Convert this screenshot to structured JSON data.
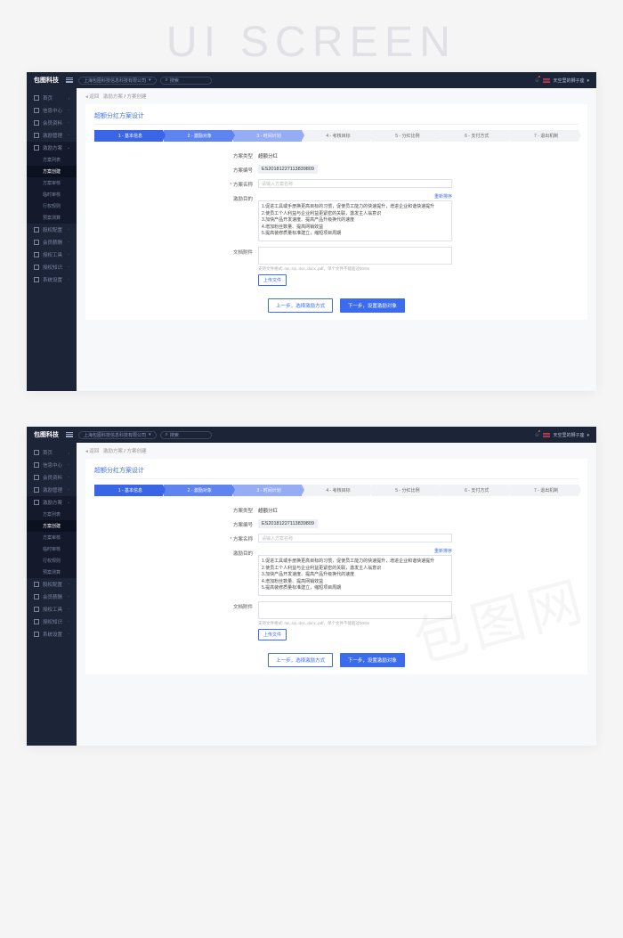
{
  "bgtitle": "UI SCREEN",
  "watermark": "包图网",
  "header": {
    "brand": "包图科技",
    "company": "上海包图科技信息科技有限公司",
    "search_ph": "搜索",
    "user": "天空里的狮子座"
  },
  "sidebar": {
    "items": [
      {
        "label": "首页",
        "expand": false
      },
      {
        "label": "信息中心",
        "expand": true
      },
      {
        "label": "会员资料",
        "expand": true
      },
      {
        "label": "激励管理",
        "expand": true
      },
      {
        "label": "激励方案",
        "expand": true,
        "active": true
      },
      {
        "label": "股权配置",
        "expand": true
      },
      {
        "label": "会员薪酬",
        "expand": true
      },
      {
        "label": "授权工具",
        "expand": true
      },
      {
        "label": "授权知识",
        "expand": true
      },
      {
        "label": "系统设置",
        "expand": true
      }
    ],
    "subs": [
      "方案列表",
      "方案创建",
      "方案审核",
      "临时审核",
      "行权规则",
      "预案测算"
    ]
  },
  "breadcrumb": {
    "back": "◂ 返回",
    "a": "激励方案",
    "b": "方案创建"
  },
  "page_title": "超额分红方案设计",
  "steps": [
    "1 - 基本信息",
    "2 - 激励对象",
    "3 - 时间计划",
    "4 - 考核目标",
    "5 - 分红比例",
    "6 - 支付方式",
    "7 - 退出机制"
  ],
  "form": {
    "type_lbl": "方案类型",
    "type_val": "超额分红",
    "code_lbl": "方案编号",
    "code_val": "ES20181227113839809",
    "name_lbl": "方案名称",
    "name_ph": "请输入方案名称",
    "goal_lbl": "激励目的",
    "reorder": "重新排序",
    "goals": "1.促进工具或手册换更高目标的习惯，促使员工能力的快速提升，增进企业和谐快速提升\n2.使员工个人利益与企业利益更紧密的关联，激发主人翁意识\n3.加快产品开发速度、提高产品升级换代的速度\n4.增加粉丝数量、提高网销效益\n5.提高装修质量标准建立，缩短项目周期",
    "file_lbl": "文档附件",
    "hint": "支持文件格式:.rar,.zip,.doc,.docx,.pdf，单个文件不能超过500m",
    "upload": "上传文件",
    "prev": "上一步，选择激励方式",
    "next": "下一步，设置激励对象"
  }
}
